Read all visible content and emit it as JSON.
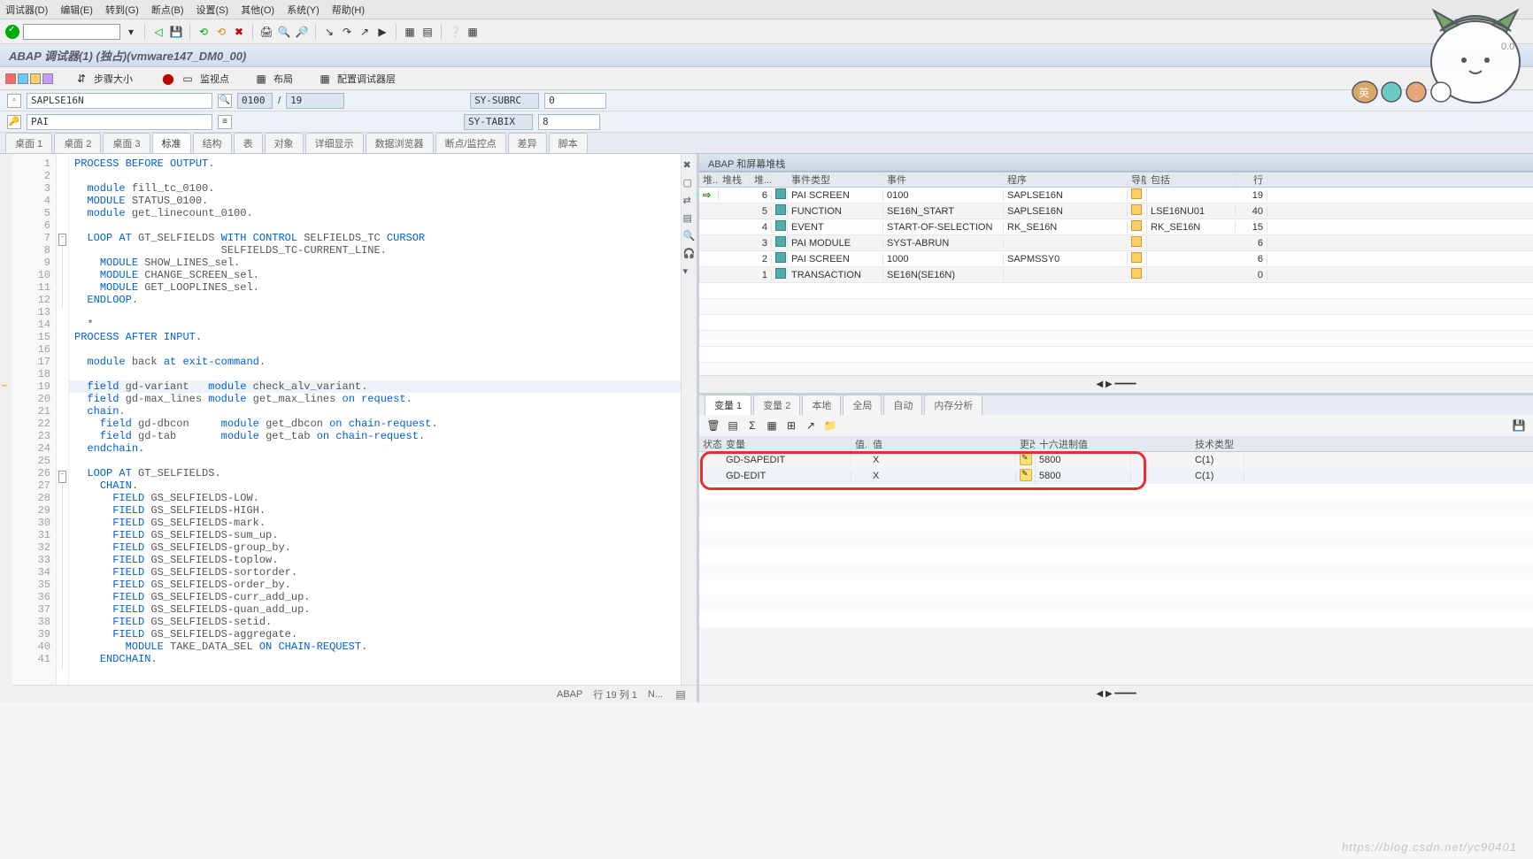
{
  "menu": {
    "items": [
      "调试器(D)",
      "编辑(E)",
      "转到(G)",
      "断点(B)",
      "设置(S)",
      "其他(O)",
      "系统(Y)",
      "帮助(H)"
    ]
  },
  "title": "ABAP 调试器(1)  (独占)(vmware147_DM0_00)",
  "tb2": {
    "step_size": "步骤大小",
    "watchpoint": "监视点",
    "layout": "布局",
    "config": "配置调试器层"
  },
  "info": {
    "prog": "SAPLSE16N",
    "screen": "0100",
    "total": "19",
    "pai": "PAI",
    "sy_subrc_lbl": "SY-SUBRC",
    "sy_subrc": "0",
    "sy_tabix_lbl": "SY-TABIX",
    "sy_tabix": "8"
  },
  "tabs": [
    "桌面 1",
    "桌面 2",
    "桌面 3",
    "标准",
    "结构",
    "表",
    "对象",
    "详细显示",
    "数据浏览器",
    "断点/监控点",
    "差异",
    "脚本"
  ],
  "active_tab": "标准",
  "code": [
    {
      "n": 1,
      "t": "PROCESS BEFORE OUTPUT.",
      "kw": [
        "PROCESS",
        "BEFORE",
        "OUTPUT"
      ]
    },
    {
      "n": 2,
      "t": ""
    },
    {
      "n": 3,
      "t": "  module fill_tc_0100.",
      "kw": [
        "module"
      ]
    },
    {
      "n": 4,
      "t": "  MODULE STATUS_0100.",
      "kw": [
        "MODULE"
      ]
    },
    {
      "n": 5,
      "t": "  module get_linecount_0100.",
      "kw": [
        "module"
      ]
    },
    {
      "n": 6,
      "t": ""
    },
    {
      "n": 7,
      "t": "  LOOP AT GT_SELFIELDS WITH CONTROL SELFIELDS_TC CURSOR",
      "kw": [
        "LOOP",
        "AT",
        "WITH",
        "CONTROL",
        "CURSOR"
      ],
      "fold": "-"
    },
    {
      "n": 8,
      "t": "                       SELFIELDS_TC-CURRENT_LINE."
    },
    {
      "n": 9,
      "t": "    MODULE SHOW_LINES_sel.",
      "kw": [
        "MODULE"
      ]
    },
    {
      "n": 10,
      "t": "    MODULE CHANGE_SCREEN_sel.",
      "kw": [
        "MODULE"
      ]
    },
    {
      "n": 11,
      "t": "    MODULE GET_LOOPLINES_sel.",
      "kw": [
        "MODULE"
      ]
    },
    {
      "n": 12,
      "t": "  ENDLOOP.",
      "kw": [
        "ENDLOOP"
      ]
    },
    {
      "n": 13,
      "t": ""
    },
    {
      "n": 14,
      "t": "  *"
    },
    {
      "n": 15,
      "t": "PROCESS AFTER INPUT.",
      "kw": [
        "PROCESS",
        "AFTER",
        "INPUT"
      ]
    },
    {
      "n": 16,
      "t": ""
    },
    {
      "n": 17,
      "t": "  module back at exit-command.",
      "kw": [
        "module",
        "at",
        "exit-command"
      ]
    },
    {
      "n": 18,
      "t": ""
    },
    {
      "n": 19,
      "t": "  field gd-variant   module check_alv_variant.",
      "kw": [
        "field",
        "module"
      ],
      "cur": true
    },
    {
      "n": 20,
      "t": "  field gd-max_lines module get_max_lines on request.",
      "kw": [
        "field",
        "module",
        "on",
        "request"
      ]
    },
    {
      "n": 21,
      "t": "  chain.",
      "kw": [
        "chain"
      ]
    },
    {
      "n": 22,
      "t": "    field gd-dbcon     module get_dbcon on chain-request.",
      "kw": [
        "field",
        "module",
        "on",
        "chain-request"
      ]
    },
    {
      "n": 23,
      "t": "    field gd-tab       module get_tab on chain-request.",
      "kw": [
        "field",
        "module",
        "on",
        "chain-request"
      ]
    },
    {
      "n": 24,
      "t": "  endchain.",
      "kw": [
        "endchain"
      ]
    },
    {
      "n": 25,
      "t": ""
    },
    {
      "n": 26,
      "t": "  LOOP AT GT_SELFIELDS.",
      "kw": [
        "LOOP",
        "AT"
      ],
      "fold": "-"
    },
    {
      "n": 27,
      "t": "    CHAIN.",
      "kw": [
        "CHAIN"
      ]
    },
    {
      "n": 28,
      "t": "      FIELD GS_SELFIELDS-LOW.",
      "kw": [
        "FIELD"
      ]
    },
    {
      "n": 29,
      "t": "      FIELD GS_SELFIELDS-HIGH.",
      "kw": [
        "FIELD"
      ]
    },
    {
      "n": 30,
      "t": "      FIELD GS_SELFIELDS-mark.",
      "kw": [
        "FIELD"
      ]
    },
    {
      "n": 31,
      "t": "      FIELD GS_SELFIELDS-sum_up.",
      "kw": [
        "FIELD"
      ]
    },
    {
      "n": 32,
      "t": "      FIELD GS_SELFIELDS-group_by.",
      "kw": [
        "FIELD"
      ]
    },
    {
      "n": 33,
      "t": "      FIELD GS_SELFIELDS-toplow.",
      "kw": [
        "FIELD"
      ]
    },
    {
      "n": 34,
      "t": "      FIELD GS_SELFIELDS-sortorder.",
      "kw": [
        "FIELD"
      ]
    },
    {
      "n": 35,
      "t": "      FIELD GS_SELFIELDS-order_by.",
      "kw": [
        "FIELD"
      ]
    },
    {
      "n": 36,
      "t": "      FIELD GS_SELFIELDS-curr_add_up.",
      "kw": [
        "FIELD"
      ]
    },
    {
      "n": 37,
      "t": "      FIELD GS_SELFIELDS-quan_add_up.",
      "kw": [
        "FIELD"
      ]
    },
    {
      "n": 38,
      "t": "      FIELD GS_SELFIELDS-setid.",
      "kw": [
        "FIELD"
      ]
    },
    {
      "n": 39,
      "t": "      FIELD GS_SELFIELDS-aggregate.",
      "kw": [
        "FIELD"
      ]
    },
    {
      "n": 40,
      "t": "        MODULE TAKE_DATA_SEL ON CHAIN-REQUEST.",
      "kw": [
        "MODULE",
        "ON",
        "CHAIN-REQUEST"
      ]
    },
    {
      "n": 41,
      "t": "    ENDCHAIN.",
      "kw": [
        "ENDCHAIN"
      ]
    }
  ],
  "code_status": {
    "lang": "ABAP",
    "pos": "行  19 列  1",
    "mode": "N..."
  },
  "stack": {
    "title": "ABAP 和屏幕堆栈",
    "headers": {
      "arr": "堆...",
      "stk": "堆栈",
      "no": "堆...",
      "et": "事件类型",
      "ev": "事件",
      "prog": "程序",
      "nav": "导航",
      "inc": "包括",
      "ln": "行"
    },
    "rows": [
      {
        "arr": "⇨",
        "no": "6",
        "et": "PAI SCREEN",
        "ev": "0100",
        "prog": "SAPLSE16N",
        "inc": "",
        "ln": "19"
      },
      {
        "arr": "",
        "no": "5",
        "et": "FUNCTION",
        "ev": "SE16N_START",
        "prog": "SAPLSE16N",
        "inc": "LSE16NU01",
        "ln": "40"
      },
      {
        "arr": "",
        "no": "4",
        "et": "EVENT",
        "ev": "START-OF-SELECTION",
        "prog": "RK_SE16N",
        "inc": "RK_SE16N",
        "ln": "15"
      },
      {
        "arr": "",
        "no": "3",
        "et": "PAI MODULE",
        "ev": "SYST-ABRUN",
        "prog": "",
        "inc": "",
        "ln": "6"
      },
      {
        "arr": "",
        "no": "2",
        "et": "PAI SCREEN",
        "ev": "1000",
        "prog": "SAPMSSY0",
        "inc": "",
        "ln": "6"
      },
      {
        "arr": "",
        "no": "1",
        "et": "TRANSACTION",
        "ev": "SE16N(SE16N)",
        "prog": "",
        "inc": "",
        "ln": "0"
      }
    ]
  },
  "var_tabs": [
    "变量 1",
    "变量 2",
    "本地",
    "全局",
    "自动",
    "内存分析"
  ],
  "var_headers": {
    "st": "状态",
    "name": "变量",
    "g": "值...",
    "val": "值",
    "ed": "更改",
    "hex": "十六进制值",
    "tt": "技术类型"
  },
  "vars": [
    {
      "name": "GD-SAPEDIT",
      "val": "X",
      "hex": "5800",
      "tt": "C(1)"
    },
    {
      "name": "GD-EDIT",
      "val": "X",
      "hex": "5800",
      "tt": "C(1)"
    }
  ],
  "footer_url": "https://blog.csdn.net/yc90401"
}
